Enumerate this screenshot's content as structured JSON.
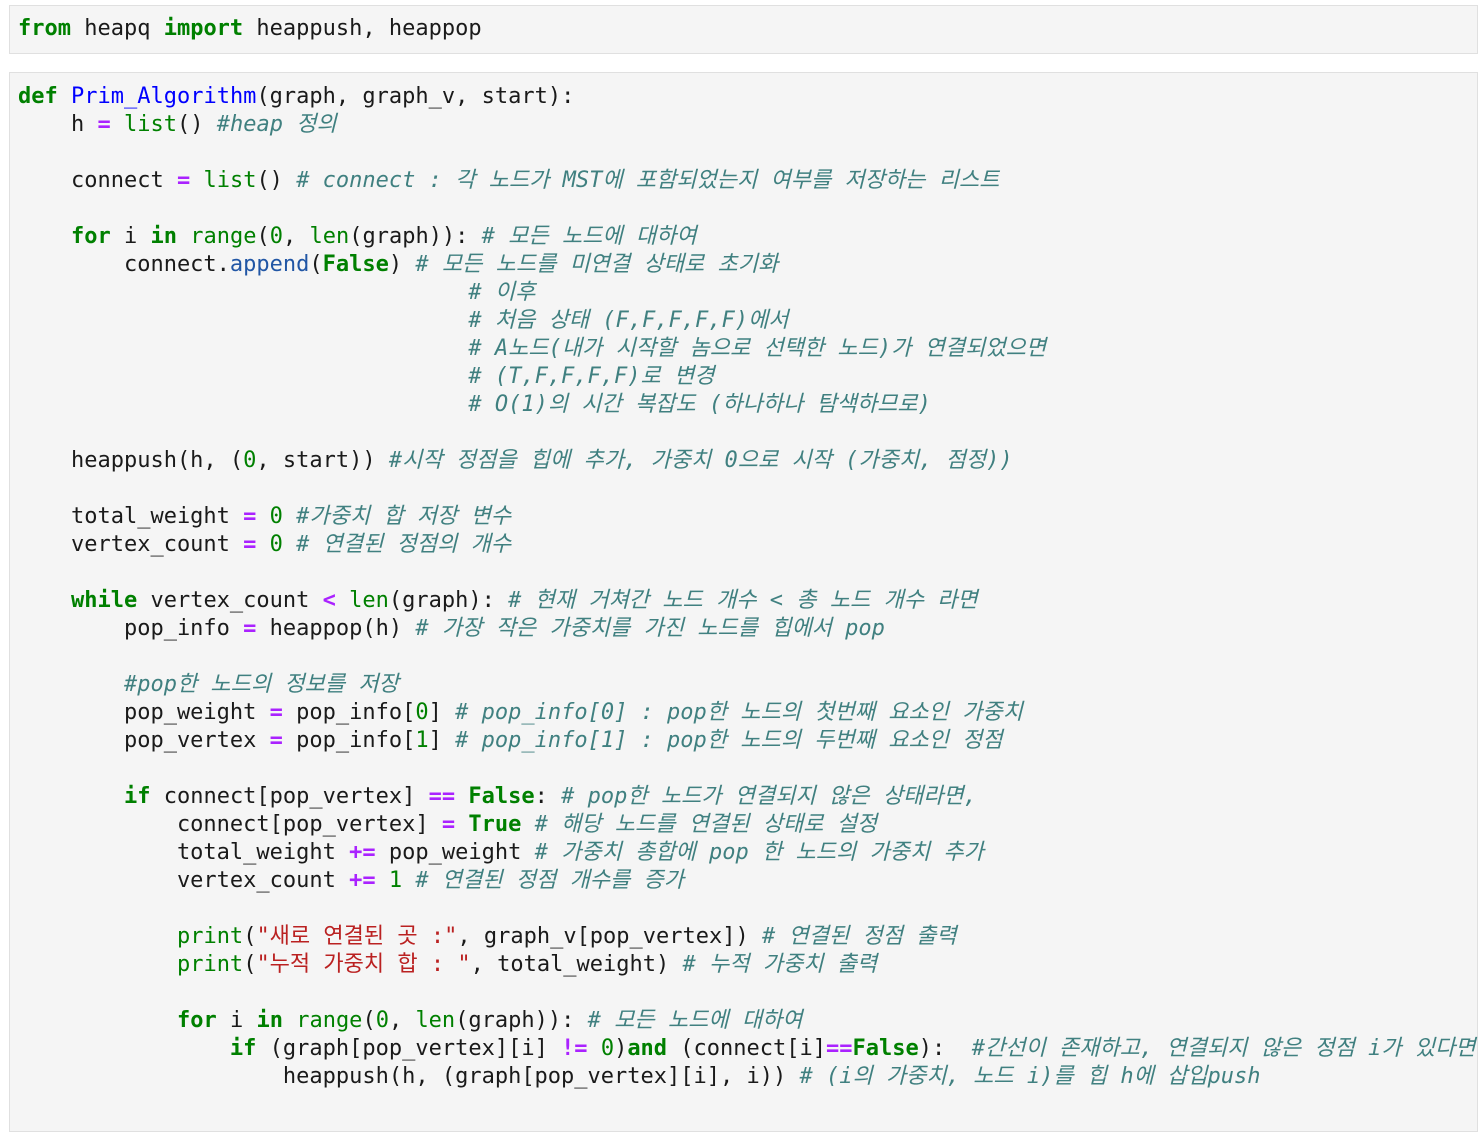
{
  "cells": [
    {
      "lines": [
        [
          [
            "kw",
            "from"
          ],
          [
            "t",
            " heapq "
          ],
          [
            "kw",
            "import"
          ],
          [
            "t",
            " heappush, heappop"
          ]
        ]
      ]
    },
    {
      "lines": [
        [
          [
            "kw",
            "def"
          ],
          [
            "t",
            " "
          ],
          [
            "fn",
            "Prim_Algorithm"
          ],
          [
            "t",
            "(graph, graph_v, start):"
          ]
        ],
        [
          [
            "t",
            "    h "
          ],
          [
            "op",
            "="
          ],
          [
            "t",
            " "
          ],
          [
            "bi",
            "list"
          ],
          [
            "t",
            "() "
          ],
          [
            "cm",
            "#heap 정의"
          ]
        ],
        [],
        [
          [
            "t",
            "    connect "
          ],
          [
            "op",
            "="
          ],
          [
            "t",
            " "
          ],
          [
            "bi",
            "list"
          ],
          [
            "t",
            "() "
          ],
          [
            "cm",
            "# connect : 각 노드가 MST에 포함되었는지 여부를 저장하는 리스트"
          ]
        ],
        [],
        [
          [
            "t",
            "    "
          ],
          [
            "kw",
            "for"
          ],
          [
            "t",
            " i "
          ],
          [
            "kw",
            "in"
          ],
          [
            "t",
            " "
          ],
          [
            "bi",
            "range"
          ],
          [
            "t",
            "("
          ],
          [
            "num",
            "0"
          ],
          [
            "t",
            ", "
          ],
          [
            "bi",
            "len"
          ],
          [
            "t",
            "(graph)): "
          ],
          [
            "cm",
            "# 모든 노드에 대하여"
          ]
        ],
        [
          [
            "t",
            "        connect."
          ],
          [
            "mt",
            "append"
          ],
          [
            "t",
            "("
          ],
          [
            "kw",
            "False"
          ],
          [
            "t",
            ") "
          ],
          [
            "cm",
            "# 모든 노드를 미연결 상태로 초기화"
          ]
        ],
        [
          [
            "t",
            "                                  "
          ],
          [
            "cm",
            "# 이후"
          ]
        ],
        [
          [
            "t",
            "                                  "
          ],
          [
            "cm",
            "# 처음 상태 (F,F,F,F,F)에서"
          ]
        ],
        [
          [
            "t",
            "                                  "
          ],
          [
            "cm",
            "# A노드(내가 시작할 놈으로 선택한 노드)가 연결되었으면"
          ]
        ],
        [
          [
            "t",
            "                                  "
          ],
          [
            "cm",
            "# (T,F,F,F,F)로 변경"
          ]
        ],
        [
          [
            "t",
            "                                  "
          ],
          [
            "cm",
            "# O(1)의 시간 복잡도 (하나하나 탐색하므로)"
          ]
        ],
        [],
        [
          [
            "t",
            "    heappush(h, ("
          ],
          [
            "num",
            "0"
          ],
          [
            "t",
            ", start)) "
          ],
          [
            "cm",
            "#시작 정점을 힙에 추가, 가중치 0으로 시작 (가중치, 점정))"
          ]
        ],
        [],
        [
          [
            "t",
            "    total_weight "
          ],
          [
            "op",
            "="
          ],
          [
            "t",
            " "
          ],
          [
            "num",
            "0"
          ],
          [
            "t",
            " "
          ],
          [
            "cm",
            "#가중치 합 저장 변수"
          ]
        ],
        [
          [
            "t",
            "    vertex_count "
          ],
          [
            "op",
            "="
          ],
          [
            "t",
            " "
          ],
          [
            "num",
            "0"
          ],
          [
            "t",
            " "
          ],
          [
            "cm",
            "# 연결된 정점의 개수"
          ]
        ],
        [],
        [
          [
            "t",
            "    "
          ],
          [
            "kw",
            "while"
          ],
          [
            "t",
            " vertex_count "
          ],
          [
            "op",
            "<"
          ],
          [
            "t",
            " "
          ],
          [
            "bi",
            "len"
          ],
          [
            "t",
            "(graph): "
          ],
          [
            "cm",
            "# 현재 거쳐간 노드 개수 < 총 노드 개수 라면"
          ]
        ],
        [
          [
            "t",
            "        pop_info "
          ],
          [
            "op",
            "="
          ],
          [
            "t",
            " heappop(h) "
          ],
          [
            "cm",
            "# 가장 작은 가중치를 가진 노드를 힙에서 pop"
          ]
        ],
        [],
        [
          [
            "t",
            "        "
          ],
          [
            "cm",
            "#pop한 노드의 정보를 저장"
          ]
        ],
        [
          [
            "t",
            "        pop_weight "
          ],
          [
            "op",
            "="
          ],
          [
            "t",
            " pop_info["
          ],
          [
            "num",
            "0"
          ],
          [
            "t",
            "] "
          ],
          [
            "cm",
            "# pop_info[0] : pop한 노드의 첫번째 요소인 가중치"
          ]
        ],
        [
          [
            "t",
            "        pop_vertex "
          ],
          [
            "op",
            "="
          ],
          [
            "t",
            " pop_info["
          ],
          [
            "num",
            "1"
          ],
          [
            "t",
            "] "
          ],
          [
            "cm",
            "# pop_info[1] : pop한 노드의 두번째 요소인 정점"
          ]
        ],
        [],
        [
          [
            "t",
            "        "
          ],
          [
            "kw",
            "if"
          ],
          [
            "t",
            " connect[pop_vertex] "
          ],
          [
            "op",
            "=="
          ],
          [
            "t",
            " "
          ],
          [
            "kw",
            "False"
          ],
          [
            "t",
            ": "
          ],
          [
            "cm",
            "# pop한 노드가 연결되지 않은 상태라면,"
          ]
        ],
        [
          [
            "t",
            "            connect[pop_vertex] "
          ],
          [
            "op",
            "="
          ],
          [
            "t",
            " "
          ],
          [
            "kw",
            "True"
          ],
          [
            "t",
            " "
          ],
          [
            "cm",
            "# 해당 노드를 연결된 상태로 설정"
          ]
        ],
        [
          [
            "t",
            "            total_weight "
          ],
          [
            "op",
            "+="
          ],
          [
            "t",
            " pop_weight "
          ],
          [
            "cm",
            "# 가중치 총합에 pop 한 노드의 가중치 추가"
          ]
        ],
        [
          [
            "t",
            "            vertex_count "
          ],
          [
            "op",
            "+="
          ],
          [
            "t",
            " "
          ],
          [
            "num",
            "1"
          ],
          [
            "t",
            " "
          ],
          [
            "cm",
            "# 연결된 정점 개수를 증가"
          ]
        ],
        [],
        [
          [
            "t",
            "            "
          ],
          [
            "bi",
            "print"
          ],
          [
            "t",
            "("
          ],
          [
            "str",
            "\"새로 연결된 곳 :\""
          ],
          [
            "t",
            ", graph_v[pop_vertex]) "
          ],
          [
            "cm",
            "# 연결된 정점 출력"
          ]
        ],
        [
          [
            "t",
            "            "
          ],
          [
            "bi",
            "print"
          ],
          [
            "t",
            "("
          ],
          [
            "str",
            "\"누적 가중치 합 : \""
          ],
          [
            "t",
            ", total_weight) "
          ],
          [
            "cm",
            "# 누적 가중치 출력"
          ]
        ],
        [],
        [
          [
            "t",
            "            "
          ],
          [
            "kw",
            "for"
          ],
          [
            "t",
            " i "
          ],
          [
            "kw",
            "in"
          ],
          [
            "t",
            " "
          ],
          [
            "bi",
            "range"
          ],
          [
            "t",
            "("
          ],
          [
            "num",
            "0"
          ],
          [
            "t",
            ", "
          ],
          [
            "bi",
            "len"
          ],
          [
            "t",
            "(graph)): "
          ],
          [
            "cm",
            "# 모든 노드에 대하여"
          ]
        ],
        [
          [
            "t",
            "                "
          ],
          [
            "kw",
            "if"
          ],
          [
            "t",
            " (graph[pop_vertex][i] "
          ],
          [
            "op",
            "!="
          ],
          [
            "t",
            " "
          ],
          [
            "num",
            "0"
          ],
          [
            "t",
            ")"
          ],
          [
            "kw",
            "and"
          ],
          [
            "t",
            " (connect[i]"
          ],
          [
            "op",
            "=="
          ],
          [
            "kw",
            "False"
          ],
          [
            "t",
            "):  "
          ],
          [
            "cm",
            "#간선이 존재하고, 연결되지 않은 정점 i가 있다면"
          ]
        ],
        [
          [
            "t",
            "                    heappush(h, (graph[pop_vertex][i], i)) "
          ],
          [
            "cm",
            "# (i의 가중치, 노드 i)를 힙 h에 삽입push"
          ]
        ]
      ]
    }
  ]
}
